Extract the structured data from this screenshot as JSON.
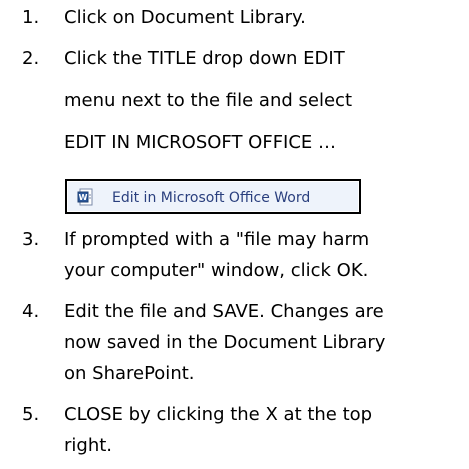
{
  "steps": [
    {
      "number": "1.",
      "lines": [
        "Click on Document Library."
      ]
    },
    {
      "number": "2.",
      "lines": [
        "Click the TITLE drop down EDIT",
        "menu next to the file and select",
        "EDIT IN MICROSOFT OFFICE …"
      ]
    },
    {
      "number": "3.",
      "lines": [
        "If prompted with a \"file may harm",
        "your computer\" window, click OK."
      ]
    },
    {
      "number": "4.",
      "lines": [
        "Edit the file and SAVE.  Changes are",
        "now saved in the Document Library",
        "on SharePoint."
      ]
    },
    {
      "number": "5.",
      "lines": [
        "CLOSE by clicking the X at the top",
        "right."
      ]
    }
  ],
  "menu": {
    "item_label": "Edit in Microsoft Office Word",
    "item_icon": "word-document-icon",
    "accent_color": "#2a3f7e"
  }
}
